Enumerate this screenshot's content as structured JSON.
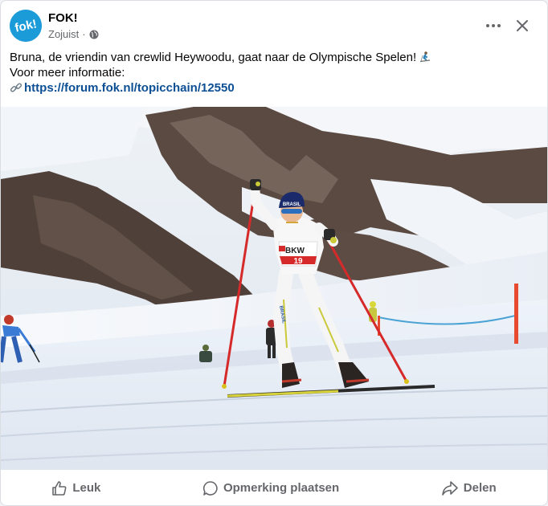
{
  "post": {
    "page_name": "FOK!",
    "avatar_text": "fok!",
    "timestamp": "Zojuist",
    "separator": "·",
    "privacy_icon": "globe-icon",
    "text_line1": "Bruna, de vriendin van crewlid Heywoodu, gaat naar de Olympische Spelen!",
    "text_line1_emoji": "skier-emoji",
    "text_line2": "Voor meer informatie:",
    "link_icon": "link-icon",
    "link_text": "https://forum.fok.nl/topicchain/12550"
  },
  "photo": {
    "bib_number": "19",
    "bib_sponsor": "BKW",
    "hat_text": "BRASIL",
    "suit_text": "BRASIL"
  },
  "actions": {
    "like_label": "Leuk",
    "comment_label": "Opmerking plaatsen",
    "share_label": "Delen"
  },
  "colors": {
    "brand_blue": "#1b9bd8",
    "link_blue": "#0d4f94",
    "secondary_text": "#65676b"
  }
}
